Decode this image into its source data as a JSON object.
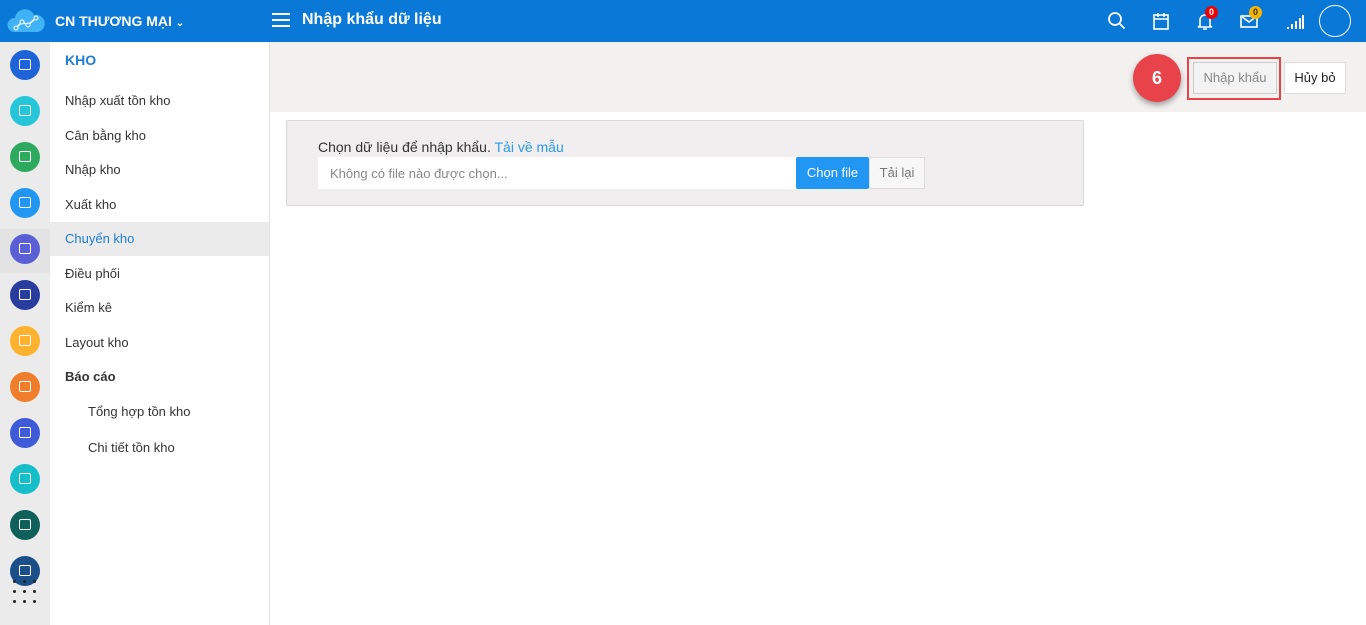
{
  "header": {
    "org": "CN THƯƠNG MẠI",
    "title": "Nhập khẩu dữ liệu",
    "notifications": "0",
    "messages": "0"
  },
  "rail": {
    "icons": [
      {
        "name": "warehouse-shelf",
        "color": "#1e63d8"
      },
      {
        "name": "users",
        "color": "#26c6da"
      },
      {
        "name": "laptop",
        "color": "#2eaa5e"
      },
      {
        "name": "cart",
        "color": "#2196f3"
      },
      {
        "name": "warehouse",
        "color": "#5a5fd6"
      },
      {
        "name": "box",
        "color": "#283d9e"
      },
      {
        "name": "package",
        "color": "#ffb22e"
      },
      {
        "name": "transfer",
        "color": "#f07d2a"
      },
      {
        "name": "document",
        "color": "#3f5bd8"
      },
      {
        "name": "calculator",
        "color": "#14bfca"
      },
      {
        "name": "delivery",
        "color": "#0f5f5a"
      },
      {
        "name": "report",
        "color": "#1b4f8a"
      }
    ]
  },
  "sidebar": {
    "heading": "KHO",
    "items": [
      {
        "label": "Nhập xuất tồn kho"
      },
      {
        "label": "Cân bằng kho"
      },
      {
        "label": "Nhập kho"
      },
      {
        "label": "Xuất kho"
      },
      {
        "label": "Chuyển kho",
        "active": true
      },
      {
        "label": "Điều phối"
      },
      {
        "label": "Kiểm kê"
      },
      {
        "label": "Layout kho"
      },
      {
        "label": "Báo cáo",
        "bold": true
      },
      {
        "label": "Tổng hợp tồn kho",
        "sub": true
      },
      {
        "label": "Chi tiết tồn kho",
        "sub": true
      }
    ]
  },
  "toolbar": {
    "step": "6",
    "import_label": "Nhập khẩu",
    "cancel_label": "Hủy bỏ"
  },
  "panel": {
    "label": "Chọn dữ liệu để nhập khẩu.",
    "template_link": "Tải về mẫu",
    "file_placeholder": "Không có file nào được chọn...",
    "choose_label": "Chọn file",
    "reload_label": "Tải lại"
  },
  "colors": {
    "primary": "#0a78d6",
    "accent": "#2196f3",
    "highlight": "#e8424a"
  }
}
